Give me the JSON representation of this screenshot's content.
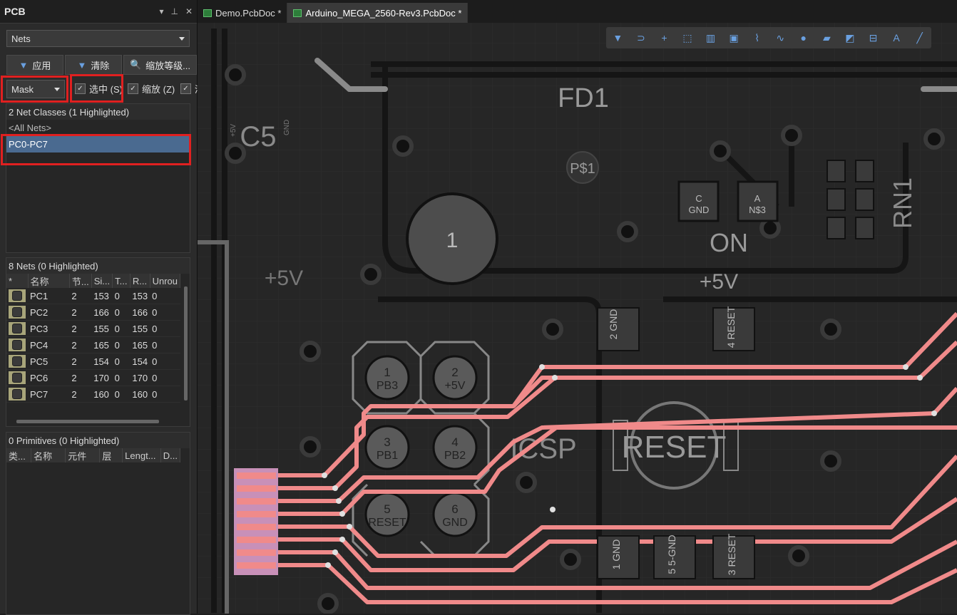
{
  "panel": {
    "title": "PCB",
    "dropdown_value": "Nets",
    "buttons": {
      "apply": "应用",
      "clear": "清除",
      "zoom_level": "缩放等级..."
    },
    "mask_value": "Mask",
    "checkboxes": {
      "select": "选中 (S)",
      "zoom": "缩放 (Z)",
      "clear_partial": "清"
    },
    "net_classes": {
      "header": "2 Net Classes (1 Highlighted)",
      "items": [
        "<All Nets>",
        "PC0-PC7"
      ]
    },
    "nets": {
      "header": "8 Nets (0 Highlighted)",
      "columns": [
        "*",
        "名称",
        "节...",
        "Si...",
        "T...",
        "R...",
        "Unrou"
      ],
      "rows": [
        {
          "name": "PC1",
          "nodes": "2",
          "signal": "153",
          "t": "0",
          "routed": "153",
          "unrouted": "0"
        },
        {
          "name": "PC2",
          "nodes": "2",
          "signal": "166",
          "t": "0",
          "routed": "166",
          "unrouted": "0"
        },
        {
          "name": "PC3",
          "nodes": "2",
          "signal": "155",
          "t": "0",
          "routed": "155",
          "unrouted": "0"
        },
        {
          "name": "PC4",
          "nodes": "2",
          "signal": "165",
          "t": "0",
          "routed": "165",
          "unrouted": "0"
        },
        {
          "name": "PC5",
          "nodes": "2",
          "signal": "154",
          "t": "0",
          "routed": "154",
          "unrouted": "0"
        },
        {
          "name": "PC6",
          "nodes": "2",
          "signal": "170",
          "t": "0",
          "routed": "170",
          "unrouted": "0"
        },
        {
          "name": "PC7",
          "nodes": "2",
          "signal": "160",
          "t": "0",
          "routed": "160",
          "unrouted": "0"
        }
      ]
    },
    "primitives": {
      "header": "0 Primitives (0 Highlighted)",
      "columns": [
        "类...",
        "名称",
        "元件",
        "层",
        "Lengt...",
        "D..."
      ]
    }
  },
  "tabs": [
    {
      "label": "Demo.PcbDoc *",
      "active": false
    },
    {
      "label": "Arduino_MEGA_2560-Rev3.PcbDoc *",
      "active": true
    }
  ],
  "board_labels": {
    "fd1": "FD1",
    "c5": "C5",
    "ps1": "P$1",
    "c_gnd_1": "C",
    "c_gnd_2": "GND",
    "a_ns3_1": "A",
    "a_ns3_2": "N$3",
    "on": "ON",
    "rn1": "RN1",
    "p5v_left": "+5V",
    "p5v_right": "+5V",
    "big_pad": "1",
    "gnd2": "2\nGND",
    "reset4": "4\nRESET",
    "icsp": "ICSP",
    "reset_btn": "RESET",
    "pads": [
      {
        "num": "1",
        "name": "PB3"
      },
      {
        "num": "2",
        "name": "+5V"
      },
      {
        "num": "3",
        "name": "PB1"
      },
      {
        "num": "4",
        "name": "PB2"
      },
      {
        "num": "5",
        "name": "RESET"
      },
      {
        "num": "6",
        "name": "GND"
      }
    ],
    "bottom": [
      "1 GND",
      "5 5-GND",
      "3 RESET"
    ],
    "c5_small_1": "+5V",
    "c5_small_2": "GND"
  }
}
